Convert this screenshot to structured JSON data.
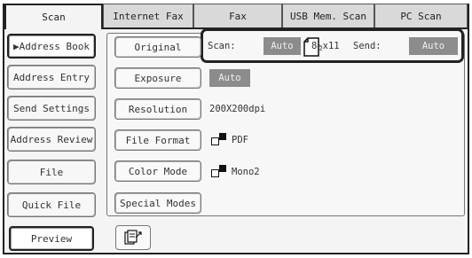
{
  "tabs": [
    {
      "label": "Scan",
      "active": true
    },
    {
      "label": "Internet Fax",
      "active": false
    },
    {
      "label": "Fax",
      "active": false
    },
    {
      "label": "USB Mem. Scan",
      "active": false
    },
    {
      "label": "PC Scan",
      "active": false
    }
  ],
  "left_menu": {
    "address_book": "▶Address Book",
    "address_entry": "Address Entry",
    "send_settings": "Send Settings",
    "address_review": "Address Review",
    "file": "File",
    "quick_file": "Quick File",
    "preview": "Preview"
  },
  "settings": {
    "original_label": "Original",
    "scan_label": "Scan:",
    "scan_value": "Auto",
    "paper_size": "8½x11",
    "send_label": "Send:",
    "send_value": "Auto",
    "exposure_label": "Exposure",
    "exposure_value": "Auto",
    "resolution_label": "Resolution",
    "resolution_value": "200X200dpi",
    "file_format_label": "File Format",
    "file_format_value": "PDF",
    "color_mode_label": "Color Mode",
    "color_mode_value": "Mono2",
    "special_modes_label": "Special Modes"
  },
  "icons": {
    "scan_original": "scan-original-icon",
    "bw": "black-white-icon",
    "paper": "paper-portrait-icon"
  }
}
